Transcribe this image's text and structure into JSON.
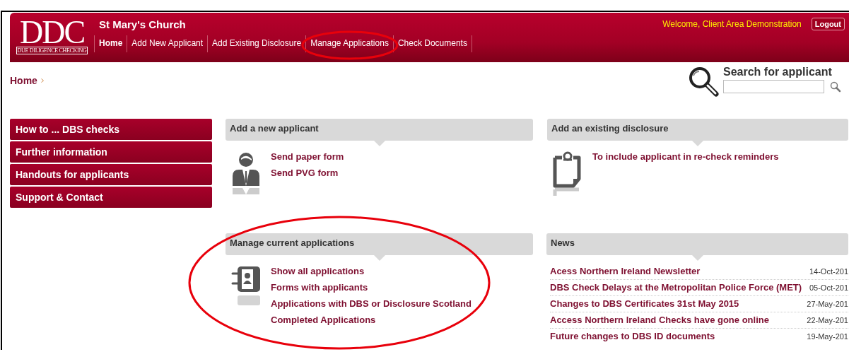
{
  "header": {
    "logo_text": "DDC",
    "logo_subtitle": "DUE DILIGENCE CHECKING",
    "site_name": "St Mary's Church",
    "welcome": "Welcome, Client Area Demonstration",
    "logout": "Logout"
  },
  "nav": [
    {
      "label": "Home",
      "selected": true,
      "circled": false
    },
    {
      "label": "Add New Applicant",
      "selected": false,
      "circled": false
    },
    {
      "label": "Add Existing Disclosure",
      "selected": false,
      "circled": false
    },
    {
      "label": "Manage Applications",
      "selected": false,
      "circled": true
    },
    {
      "label": "Check Documents",
      "selected": false,
      "circled": false
    }
  ],
  "breadcrumb": [
    "Home"
  ],
  "search": {
    "title": "Search for applicant"
  },
  "sidebar": {
    "items": [
      "How to ... DBS checks",
      "Further information",
      "Handouts for applicants",
      "Support & Contact"
    ]
  },
  "panels": [
    {
      "title": "Add a new applicant",
      "kind": "links",
      "circled": false,
      "links": [
        "Send paper form",
        "Send PVG form"
      ]
    },
    {
      "title": "Add an existing disclosure",
      "kind": "links",
      "circled": false,
      "links": [
        "To include applicant in re-check reminders"
      ]
    },
    {
      "title": "Manage current applications",
      "kind": "links",
      "circled": true,
      "links": [
        "Show all applications",
        "Forms with applicants",
        "Applications with DBS or Disclosure Scotland",
        "Completed Applications"
      ]
    },
    {
      "title": "News",
      "kind": "news",
      "circled": false,
      "items": [
        {
          "title": "Acess Northern Ireland Newsletter",
          "date": "14-Oct-201"
        },
        {
          "title": "DBS Check Delays at the Metropolitan Police Force (MET)",
          "date": "05-Oct-201"
        },
        {
          "title": "Changes to DBS Certificates 31st May 2015",
          "date": "27-May-201"
        },
        {
          "title": "Access Northern Ireland Checks have gone online",
          "date": "22-May-201"
        },
        {
          "title": "Future changes to DBS ID documents",
          "date": "19-May-201"
        }
      ]
    }
  ]
}
